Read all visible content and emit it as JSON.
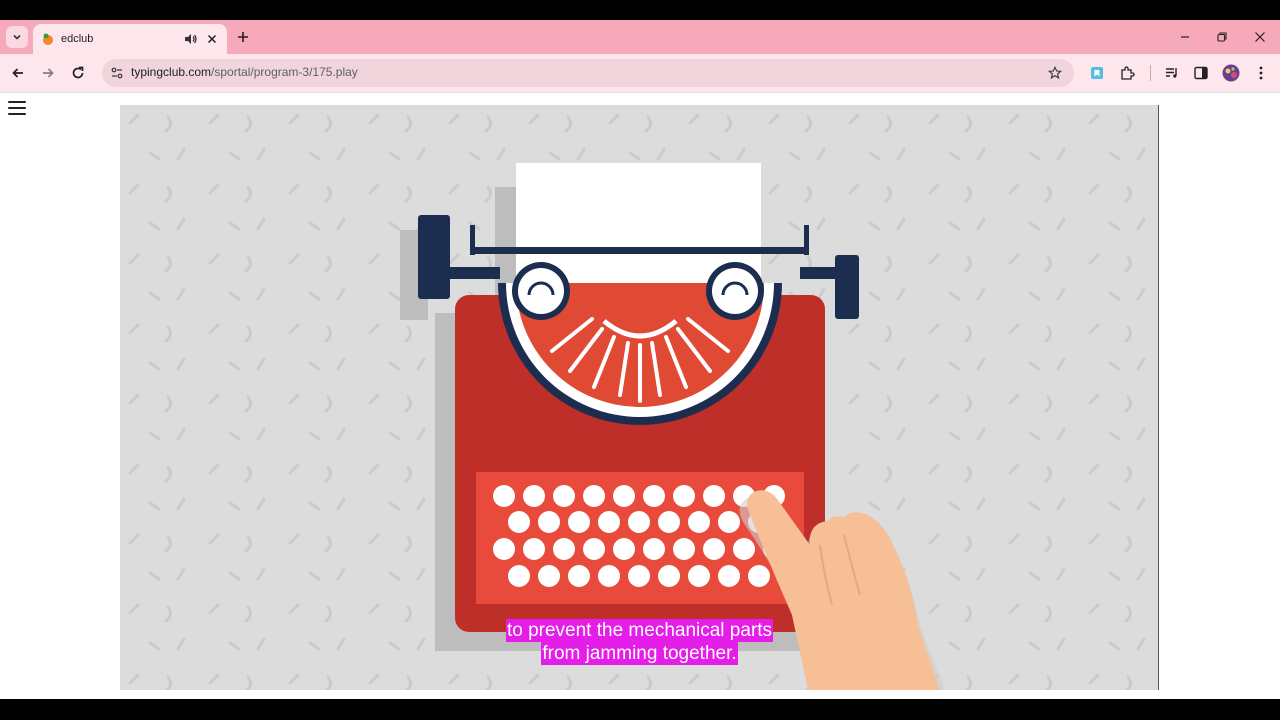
{
  "browser": {
    "tab": {
      "title": "edclub",
      "favicon": "edclub-logo-icon",
      "audio_icon": "speaker-icon",
      "close_icon": "close-icon"
    },
    "new_tab_icon": "plus-icon",
    "window_controls": [
      "minimize-icon",
      "restore-icon",
      "close-icon"
    ],
    "toolbar": {
      "back_icon": "back-arrow-icon",
      "forward_icon": "forward-arrow-icon",
      "reload_icon": "reload-icon",
      "url_host": "typingclub.com",
      "url_path": "/sportal/program-3/175.play",
      "bookmark_icon": "star-icon",
      "extensions": [
        "extension-bookmark-icon",
        "puzzle-icon",
        "media-controls-icon",
        "side-panel-icon",
        "profile-avatar",
        "more-menu-icon"
      ]
    }
  },
  "page": {
    "menu_icon": "hamburger-menu-icon",
    "video": {
      "scene": "typewriter-illustration",
      "captions": [
        "to prevent the mechanical parts",
        "from jamming together."
      ]
    }
  },
  "colors": {
    "tabstrip": "#f5a9bb",
    "toolbar": "#fde7ec",
    "typewriter_red": "#c0332d",
    "typewriter_navy": "#1c2e50",
    "caption_bg": "#e41ee8"
  }
}
